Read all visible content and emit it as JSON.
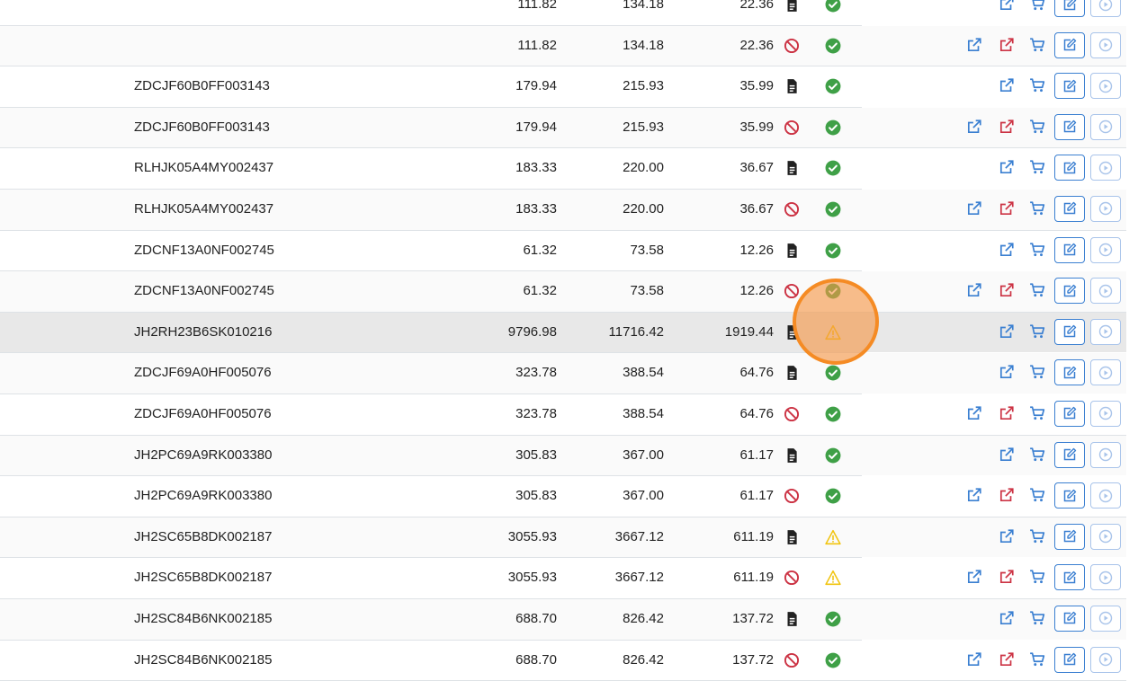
{
  "colors": {
    "accent": "#3a7fd1",
    "danger": "#cc3344",
    "success": "#3fa047",
    "warning": "#f1c40f",
    "cursor": "#f58b24"
  },
  "rows": [
    {
      "vin": "",
      "amount1": "111.82",
      "amount2": "134.18",
      "amount3": "22.36",
      "type_icon": "document-icon",
      "status_icon": "check-circle-icon"
    },
    {
      "vin": "",
      "amount1": "111.82",
      "amount2": "134.18",
      "amount3": "22.36",
      "type_icon": "blocked-icon",
      "status_icon": "check-circle-icon"
    },
    {
      "vin": "ZDCJF60B0FF003143",
      "amount1": "179.94",
      "amount2": "215.93",
      "amount3": "35.99",
      "type_icon": "document-icon",
      "status_icon": "check-circle-icon"
    },
    {
      "vin": "ZDCJF60B0FF003143",
      "amount1": "179.94",
      "amount2": "215.93",
      "amount3": "35.99",
      "type_icon": "blocked-icon",
      "status_icon": "check-circle-icon"
    },
    {
      "vin": "RLHJK05A4MY002437",
      "amount1": "183.33",
      "amount2": "220.00",
      "amount3": "36.67",
      "type_icon": "document-icon",
      "status_icon": "check-circle-icon"
    },
    {
      "vin": "RLHJK05A4MY002437",
      "amount1": "183.33",
      "amount2": "220.00",
      "amount3": "36.67",
      "type_icon": "blocked-icon",
      "status_icon": "check-circle-icon"
    },
    {
      "vin": "ZDCNF13A0NF002745",
      "amount1": "61.32",
      "amount2": "73.58",
      "amount3": "12.26",
      "type_icon": "document-icon",
      "status_icon": "check-circle-icon"
    },
    {
      "vin": "ZDCNF13A0NF002745",
      "amount1": "61.32",
      "amount2": "73.58",
      "amount3": "12.26",
      "type_icon": "blocked-icon",
      "status_icon": "check-circle-icon"
    },
    {
      "vin": "JH2RH23B6SK010216",
      "amount1": "9796.98",
      "amount2": "11716.42",
      "amount3": "1919.44",
      "type_icon": "document-icon",
      "status_icon": "warning-icon"
    },
    {
      "vin": "ZDCJF69A0HF005076",
      "amount1": "323.78",
      "amount2": "388.54",
      "amount3": "64.76",
      "type_icon": "document-icon",
      "status_icon": "check-circle-icon"
    },
    {
      "vin": "ZDCJF69A0HF005076",
      "amount1": "323.78",
      "amount2": "388.54",
      "amount3": "64.76",
      "type_icon": "blocked-icon",
      "status_icon": "check-circle-icon"
    },
    {
      "vin": "JH2PC69A9RK003380",
      "amount1": "305.83",
      "amount2": "367.00",
      "amount3": "61.17",
      "type_icon": "document-icon",
      "status_icon": "check-circle-icon"
    },
    {
      "vin": "JH2PC69A9RK003380",
      "amount1": "305.83",
      "amount2": "367.00",
      "amount3": "61.17",
      "type_icon": "blocked-icon",
      "status_icon": "check-circle-icon"
    },
    {
      "vin": "JH2SC65B8DK002187",
      "amount1": "3055.93",
      "amount2": "3667.12",
      "amount3": "611.19",
      "type_icon": "document-icon",
      "status_icon": "warning-icon"
    },
    {
      "vin": "JH2SC65B8DK002187",
      "amount1": "3055.93",
      "amount2": "3667.12",
      "amount3": "611.19",
      "type_icon": "blocked-icon",
      "status_icon": "warning-icon"
    },
    {
      "vin": "JH2SC84B6NK002185",
      "amount1": "688.70",
      "amount2": "826.42",
      "amount3": "137.72",
      "type_icon": "document-icon",
      "status_icon": "check-circle-icon"
    },
    {
      "vin": "JH2SC84B6NK002185",
      "amount1": "688.70",
      "amount2": "826.42",
      "amount3": "137.72",
      "type_icon": "blocked-icon",
      "status_icon": "check-circle-icon"
    }
  ],
  "row_actions": {
    "document_row": [
      "external-link-icon",
      "cart-icon",
      "edit-icon",
      "play-circle-icon"
    ],
    "blocked_row": [
      "external-link-icon",
      "external-link-red-icon",
      "cart-icon",
      "edit-icon",
      "play-circle-icon"
    ]
  },
  "highlighted_row_index": 8
}
